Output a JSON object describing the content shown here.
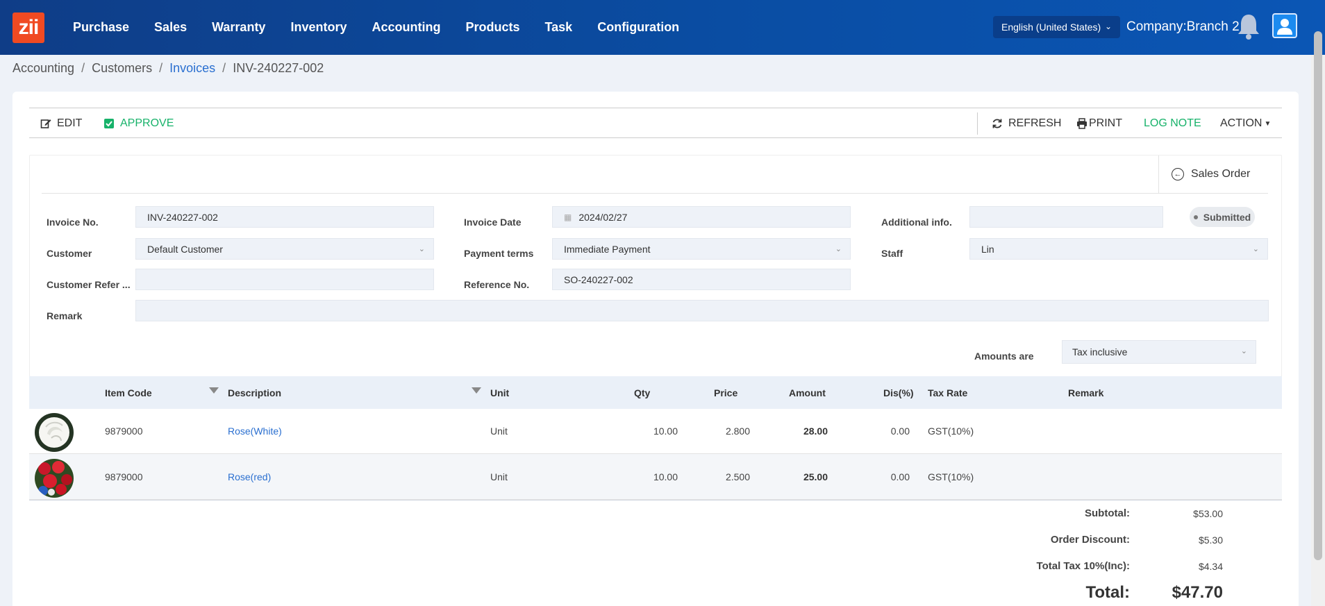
{
  "app": {
    "logo": "zii",
    "nav": [
      "Purchase",
      "Sales",
      "Warranty",
      "Inventory",
      "Accounting",
      "Products",
      "Task",
      "Configuration"
    ],
    "language": "English (United States)",
    "company": "Company:Branch 2"
  },
  "breadcrumb": {
    "items": [
      "Accounting",
      "Customers",
      "Invoices",
      "INV-240227-002"
    ],
    "separator": "/"
  },
  "toolbar": {
    "edit": "EDIT",
    "approve": "APPROVE",
    "refresh": "REFRESH",
    "print": "PRINT",
    "log_note": "LOG NOTE",
    "action": "ACTION"
  },
  "form": {
    "sales_order_link": "Sales Order",
    "status": "Submitted",
    "invoice_no_label": "Invoice No.",
    "invoice_no": "INV-240227-002",
    "invoice_date_label": "Invoice Date",
    "invoice_date": "2024/02/27",
    "additional_info_label": "Additional info.",
    "additional_info": "",
    "customer_label": "Customer",
    "customer": "Default Customer",
    "payment_terms_label": "Payment terms",
    "payment_terms": "Immediate Payment",
    "staff_label": "Staff",
    "staff": "Lin",
    "customer_ref_label": "Customer Refer ...",
    "customer_ref": "",
    "reference_no_label": "Reference No.",
    "reference_no": "SO-240227-002",
    "remark_label": "Remark",
    "remark": "",
    "amounts_are_label": "Amounts are",
    "amounts_are": "Tax inclusive"
  },
  "table": {
    "headers": {
      "item_code": "Item Code",
      "description": "Description",
      "unit": "Unit",
      "qty": "Qty",
      "price": "Price",
      "amount": "Amount",
      "discount": "Dis(%)",
      "tax_rate": "Tax Rate",
      "remark": "Remark"
    },
    "rows": [
      {
        "item_code": "9879000",
        "description": "Rose(White)",
        "unit": "Unit",
        "qty": "10.00",
        "price": "2.800",
        "amount": "28.00",
        "discount": "0.00",
        "tax_rate": "GST(10%)",
        "remark": ""
      },
      {
        "item_code": "9879000",
        "description": "Rose(red)",
        "unit": "Unit",
        "qty": "10.00",
        "price": "2.500",
        "amount": "25.00",
        "discount": "0.00",
        "tax_rate": "GST(10%)",
        "remark": ""
      }
    ]
  },
  "totals": {
    "subtotal_label": "Subtotal:",
    "subtotal": "$53.00",
    "discount_label": "Order Discount:",
    "discount": "$5.30",
    "tax_label": "Total Tax 10%(Inc):",
    "tax": "$4.34",
    "total_label": "Total:",
    "total": "$47.70"
  },
  "colors": {
    "header_bg": "#0a4da3",
    "link": "#2a6fd0",
    "approve": "#17b26a",
    "logo": "#f04a22"
  }
}
